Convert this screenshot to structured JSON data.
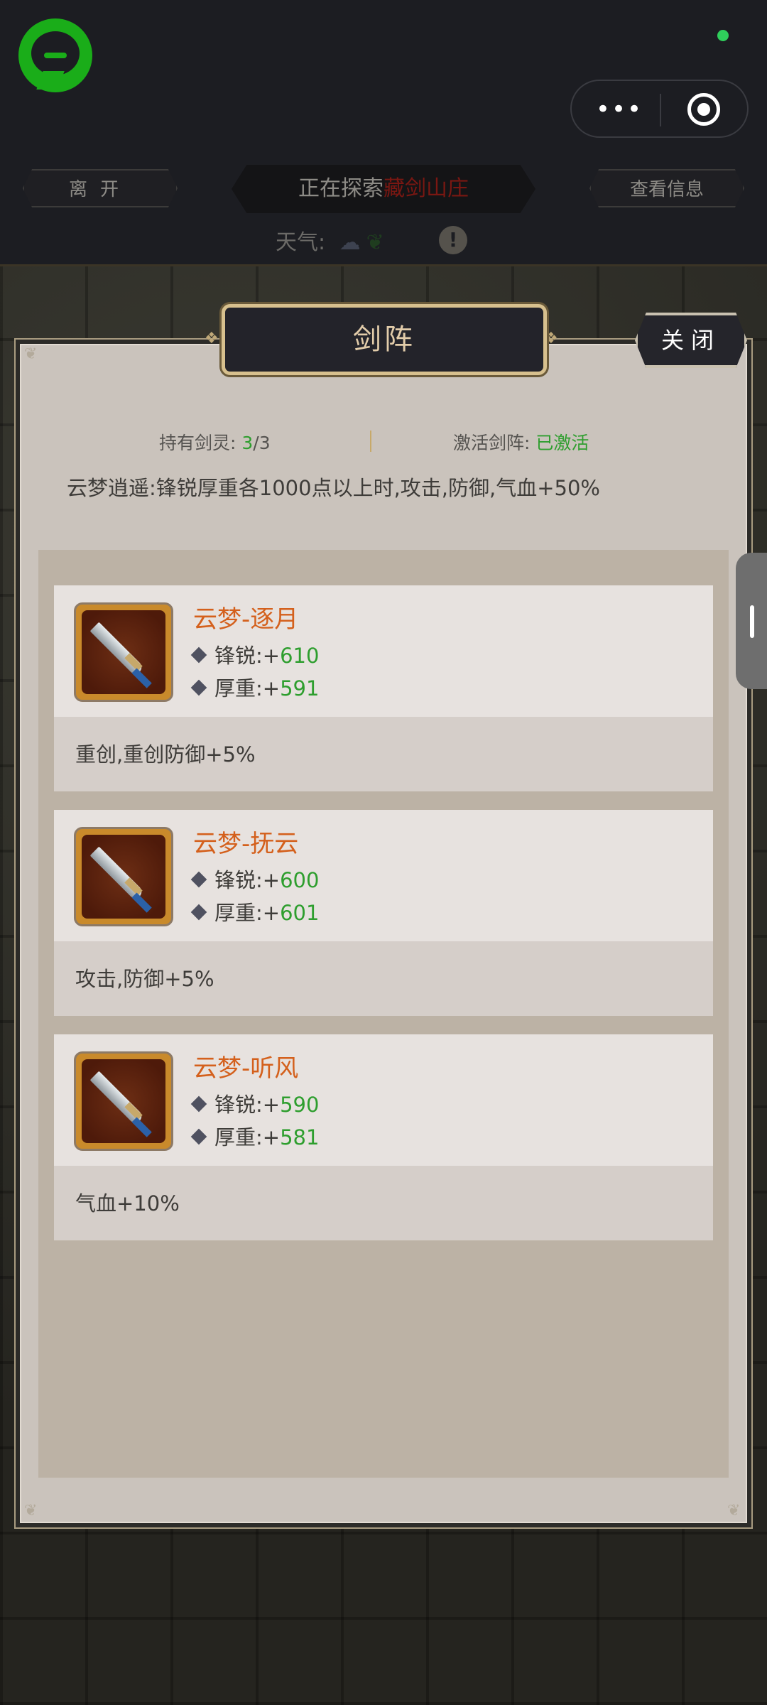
{
  "header": {
    "leave_label": "离开",
    "explore_prefix": "正在探索",
    "explore_place": "藏剑山庄",
    "info_label": "查看信息",
    "weather_label": "天气:",
    "weather_icon": "cloud-weather-icon",
    "alert_symbol": "!"
  },
  "capsule": {
    "more_symbol": "•••"
  },
  "panel": {
    "title": "剑阵",
    "close_label": "关闭",
    "holding_label": "持有剑灵:",
    "holding_current": "3",
    "holding_total": "/3",
    "active_label": "激活剑阵:",
    "active_value": "已激活",
    "bonus_text": "云梦逍遥:锋锐厚重各1000点以上时,攻击,防御,气血+50%"
  },
  "swords": [
    {
      "name": "云梦-逐月",
      "attr1_label": "锋锐:",
      "attr1_sign": "+",
      "attr1_value": "610",
      "attr2_label": "厚重:",
      "attr2_sign": "+",
      "attr2_value": "591",
      "effect": "重创,重创防御+5%",
      "icon": "sword-icon"
    },
    {
      "name": "云梦-抚云",
      "attr1_label": "锋锐:",
      "attr1_sign": "+",
      "attr1_value": "600",
      "attr2_label": "厚重:",
      "attr2_sign": "+",
      "attr2_value": "601",
      "effect": "攻击,防御+5%",
      "icon": "sword-icon"
    },
    {
      "name": "云梦-听风",
      "attr1_label": "锋锐:",
      "attr1_sign": "+",
      "attr1_value": "590",
      "attr2_label": "厚重:",
      "attr2_sign": "+",
      "attr2_value": "581",
      "effect": "气血+10%",
      "icon": "sword-icon"
    }
  ],
  "colors": {
    "name_orange": "#d4601c",
    "value_green": "#2e9e2e",
    "wechat_green": "#1aad19"
  }
}
